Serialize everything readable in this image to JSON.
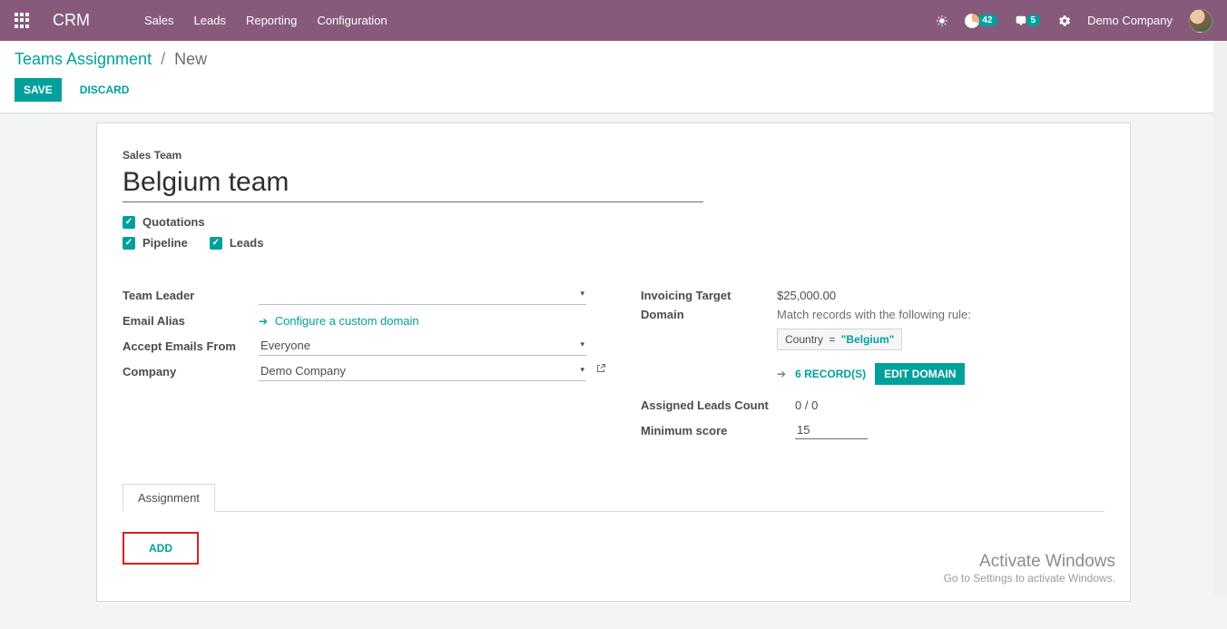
{
  "nav": {
    "brand": "CRM",
    "menu": [
      "Sales",
      "Leads",
      "Reporting",
      "Configuration"
    ],
    "activities_badge": "42",
    "messages_badge": "5",
    "company": "Demo Company"
  },
  "breadcrumbs": {
    "parent": "Teams Assignment",
    "sep": "/",
    "current": "New"
  },
  "buttons": {
    "save": "SAVE",
    "discard": "DISCARD",
    "add": "ADD",
    "edit_domain": "EDIT DOMAIN"
  },
  "form": {
    "title_label": "Sales Team",
    "title": "Belgium team",
    "checks": {
      "quotations": {
        "label": "Quotations",
        "checked": true
      },
      "pipeline": {
        "label": "Pipeline",
        "checked": true
      },
      "leads": {
        "label": "Leads",
        "checked": true
      }
    },
    "left": {
      "team_leader": {
        "label": "Team Leader",
        "value": ""
      },
      "email_alias": {
        "label": "Email Alias",
        "link_text": "Configure a custom domain"
      },
      "accept_from": {
        "label": "Accept Emails From",
        "value": "Everyone"
      },
      "company": {
        "label": "Company",
        "value": "Demo Company"
      }
    },
    "right": {
      "invoicing_target": {
        "label": "Invoicing Target",
        "value": "$25,000.00"
      },
      "domain": {
        "label": "Domain",
        "hint": "Match records with the following rule:",
        "field": "Country",
        "eq": "=",
        "value": "\"Belgium\"",
        "records_link": "6 RECORD(S)"
      },
      "assigned_leads": {
        "label": "Assigned Leads Count",
        "value": "0 / 0"
      },
      "min_score": {
        "label": "Minimum score",
        "value": "15"
      }
    }
  },
  "tabs": {
    "assignment": "Assignment"
  },
  "watermark": {
    "title": "Activate Windows",
    "sub": "Go to Settings to activate Windows."
  }
}
